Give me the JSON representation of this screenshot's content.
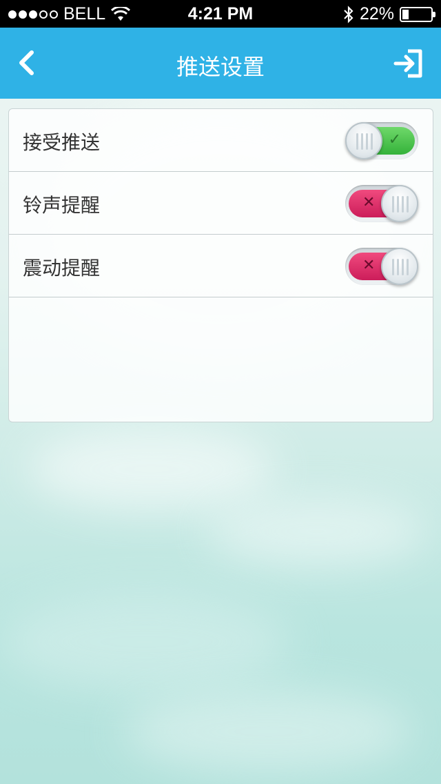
{
  "status_bar": {
    "carrier": "BELL",
    "time": "4:21 PM",
    "battery_percent_text": "22%",
    "battery_level": 0.22,
    "signal_bars_on": 3,
    "signal_bars_total": 5,
    "icons": [
      "wifi-icon",
      "bluetooth-icon",
      "battery-icon"
    ]
  },
  "nav": {
    "title": "推送设置",
    "back_icon": "chevron-left-icon",
    "exit_icon": "logout-icon"
  },
  "settings": [
    {
      "label": "接受推送",
      "enabled": true
    },
    {
      "label": "铃声提醒",
      "enabled": false
    },
    {
      "label": "震动提醒",
      "enabled": false
    }
  ],
  "toggle_marks": {
    "on": "✓",
    "off": "✕"
  },
  "colors": {
    "nav_bar": "#2fb2e6",
    "toggle_on": "#34b23a",
    "toggle_off": "#cc1d5a"
  }
}
